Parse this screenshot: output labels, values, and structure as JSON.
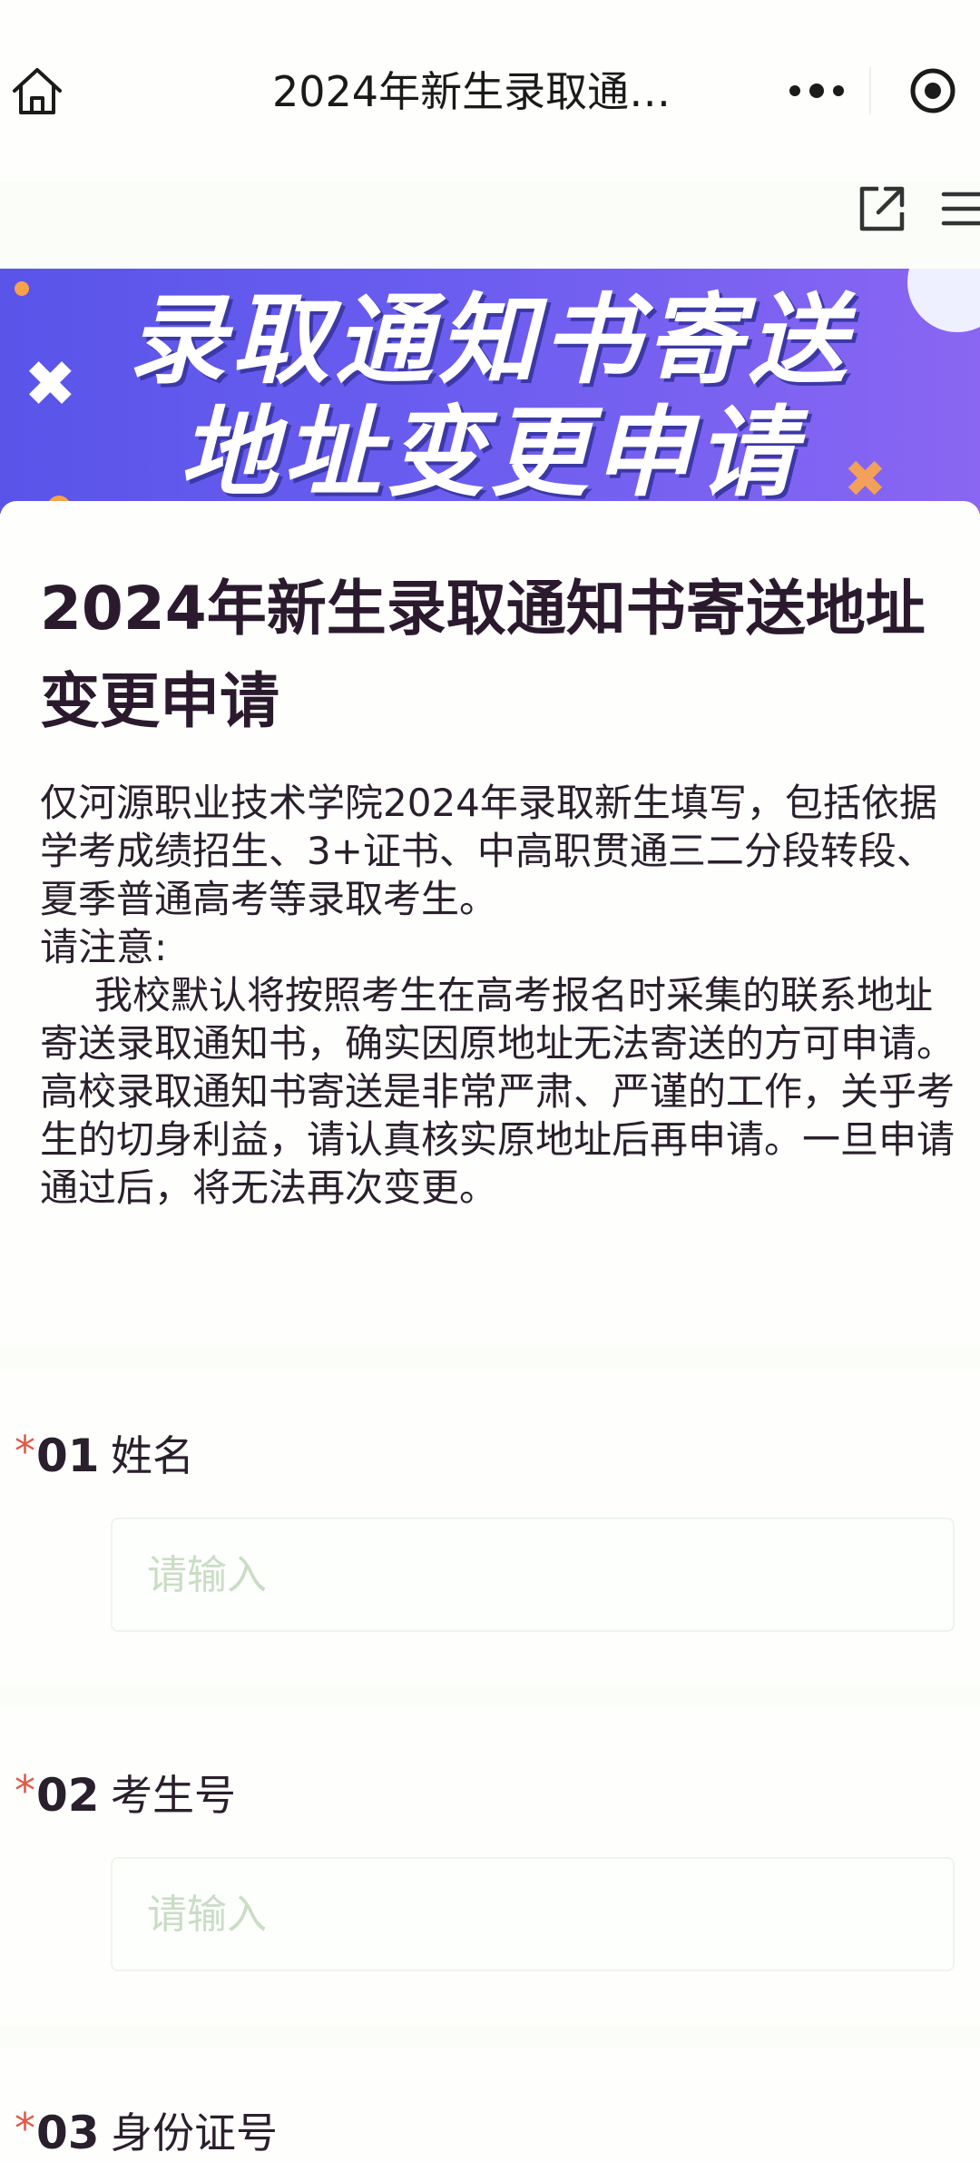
{
  "nav": {
    "title": "2024年新生录取通…"
  },
  "banner": {
    "line1": "录取通知书寄送",
    "line2": "地址变更申请"
  },
  "page": {
    "title": "2024年新生录取通知书寄送地址变更申请",
    "description": [
      "仅河源职业技术学院2024年录取新生填写，包括依据学考成绩招生、3+证书、中高职贯通三二分段转段、夏季普通高考等录取考生。",
      "请注意:",
      "我校默认将按照考生在高考报名时采集的联系地址寄送录取通知书，确实因原地址无法寄送的方可申请。高校录取通知书寄送是非常严肃、严谨的工作，关乎考生的切身利益，请认真核实原地址后再申请。一旦申请通过后，将无法再次变更。"
    ]
  },
  "questions": [
    {
      "required_mark": "*",
      "number": "01",
      "label": "姓名",
      "placeholder": "请输入"
    },
    {
      "required_mark": "*",
      "number": "02",
      "label": "考生号",
      "placeholder": "请输入"
    },
    {
      "required_mark": "*",
      "number": "03",
      "label": "身份证号"
    }
  ],
  "colors": {
    "banner_start": "#5a54e9",
    "banner_end": "#8a66f2",
    "required_star": "#e05a4a",
    "placeholder": "#c9ddc5"
  }
}
